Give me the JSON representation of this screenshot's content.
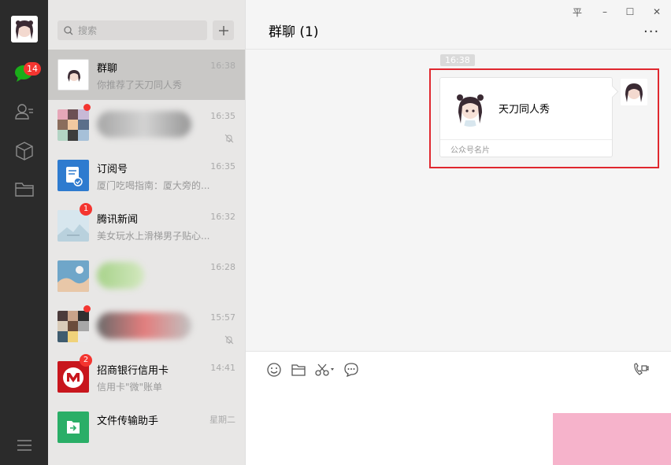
{
  "rail": {
    "unread_badge": "14"
  },
  "search": {
    "placeholder": "搜索"
  },
  "sessions": [
    {
      "name": "群聊",
      "preview": "你推荐了天刀同人秀",
      "time": "16:38",
      "active": true
    },
    {
      "name": "",
      "preview": "",
      "time": "16:35",
      "muted": true,
      "red_dot": true
    },
    {
      "name": "订阅号",
      "preview": "厦门吃喝指南：厦大旁的...",
      "time": "16:35"
    },
    {
      "name": "腾讯新闻",
      "preview": "美女玩水上滑梯男子贴心...",
      "time": "16:32",
      "unread": "1"
    },
    {
      "name": "",
      "preview": "",
      "time": "16:28"
    },
    {
      "name": "",
      "preview": "",
      "time": "15:57",
      "muted": true,
      "red_dot": true
    },
    {
      "name": "招商银行信用卡",
      "preview": "信用卡\"微\"账单",
      "time": "14:41",
      "unread": "2"
    },
    {
      "name": "文件传输助手",
      "preview": "",
      "time": "星期二"
    }
  ],
  "chat": {
    "title": "群聊 (1)",
    "more": "···",
    "timestamp": "16:38",
    "card": {
      "name": "天刀同人秀",
      "footer": "公众号名片"
    }
  },
  "window": {
    "pin": "平",
    "minimize": "–",
    "maximize": "☐",
    "close": "✕"
  },
  "colors": {
    "accent_red": "#e0282f",
    "badge_red": "#f43530",
    "wechat_green": "#1aad19"
  }
}
